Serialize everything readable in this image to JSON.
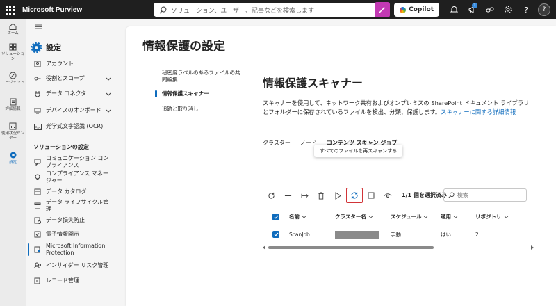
{
  "topbar": {
    "app_name": "Microsoft Purview",
    "search_placeholder": "ソリューション、ユーザー、記事などを検索します",
    "copilot_label": "Copilot",
    "notification_badge": "1",
    "avatar_initial": "?"
  },
  "rail": [
    {
      "label": "ホーム",
      "icon": "home-icon"
    },
    {
      "label": "ソリューション",
      "icon": "apps-icon"
    },
    {
      "label": "エージェント",
      "icon": "agent-icon"
    },
    {
      "label": "詳細情報",
      "icon": "doc-icon"
    },
    {
      "label": "使用状況センター",
      "icon": "chart-icon"
    },
    {
      "label": "設定",
      "icon": "gear-icon"
    }
  ],
  "nav": {
    "title": "設定",
    "items": [
      {
        "label": "アカウント",
        "chevron": false
      },
      {
        "label": "役割とスコープ",
        "chevron": true
      },
      {
        "label": "データ コネクタ",
        "chevron": true
      },
      {
        "label": "デバイスのオンボード",
        "chevron": true
      },
      {
        "label": "光学式文字認識 (OCR)",
        "chevron": false
      }
    ],
    "section_title": "ソリューションの設定",
    "solution_items": [
      {
        "label": "コミュニケーション コンプライアンス"
      },
      {
        "label": "コンプライアンス マネージャー"
      },
      {
        "label": "データ カタログ"
      },
      {
        "label": "データ ライフサイクル管理"
      },
      {
        "label": "データ損失防止"
      },
      {
        "label": "電子情報開示"
      },
      {
        "label": "Microsoft Information Protection"
      },
      {
        "label": "インサイダー リスク管理"
      },
      {
        "label": "レコード管理"
      }
    ]
  },
  "main": {
    "page_title": "情報保護の設定",
    "sub_nav": [
      {
        "label": "秘密度ラベルのあるファイルの共同編集"
      },
      {
        "label": "情報保護スキャナー"
      },
      {
        "label": "追跡と取り消し"
      }
    ],
    "heading": "情報保護スキャナー",
    "description": "スキャナーを使用して、ネットワーク共有およびオンプレミスの SharePoint ドキュメント ライブラリとフォルダーに保存されているファイルを検出、分類、保護します。",
    "description_link": "スキャナーに関する詳細情報",
    "tabs": [
      {
        "label": "クラスター"
      },
      {
        "label": "ノード"
      },
      {
        "label": "コンテンツ スキャン ジョブ"
      }
    ],
    "tooltip": "すべてのファイルを再スキャンする",
    "selection_count": "1/1 個を選択済み",
    "search_placeholder": "検索",
    "table": {
      "headers": [
        "名前",
        "クラスター名",
        "スケジュール",
        "適用",
        "リポジトリ"
      ],
      "rows": [
        {
          "name": "ScanJob",
          "cluster": "",
          "schedule": "手動",
          "apply": "はい",
          "repos": "2"
        }
      ]
    }
  },
  "colors": {
    "accent": "#0f6cbd",
    "highlight_border": "#d13438",
    "topbar": "#1f1f1f"
  }
}
